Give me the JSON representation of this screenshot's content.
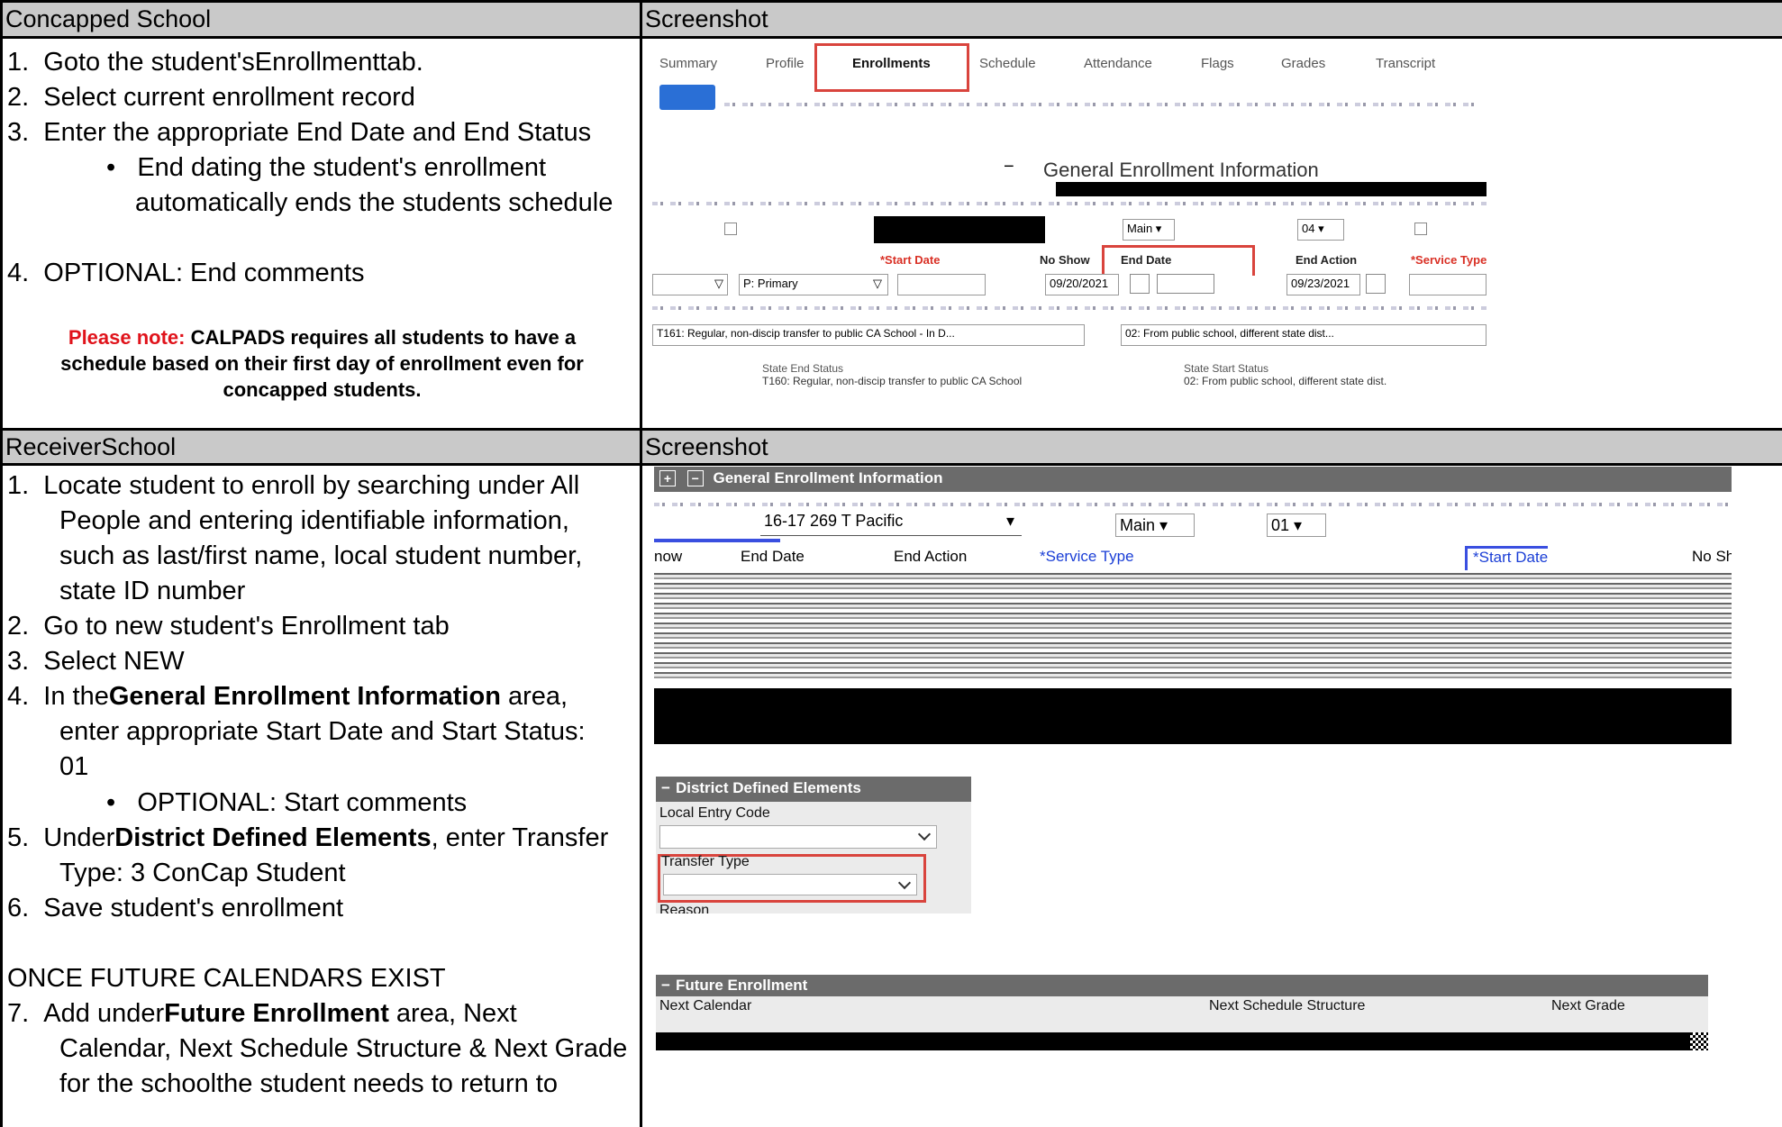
{
  "section1": {
    "left_header": "Concapped School",
    "right_header": "Screenshot",
    "steps": [
      "1.  Goto the student'sEnrollmenttab.",
      "2.  Select current enrollment record",
      "3.  Enter the appropriate End Date and End Status",
      "•   End dating the student's enrollment",
      "automatically ends the students schedule",
      "4.  OPTIONAL: End comments"
    ],
    "note_red": "Please note:",
    "note_line1": " CALPADS requires all students to have a",
    "note_line2": "schedule based on their first day of enrollment even for",
    "note_line3": "concapped students."
  },
  "screenshot1": {
    "tabs": [
      "Summary",
      "Profile",
      "Enrollments",
      "Schedule",
      "Attendance",
      "Flags",
      "Grades",
      "Transcript"
    ],
    "section_title": "General Enrollment Information",
    "collapse_glyph": "−",
    "calendar_value": "Main ▾",
    "grade_value": "04 ▾",
    "start_date_label": "*Start Date",
    "no_show_label": "No Show",
    "end_date_label": "End Date",
    "end_action_label": "End Action",
    "service_type_label": "*Service Type",
    "service_value": "P: Primary",
    "dropdown_glyph": "▽",
    "no_show_date": "09/20/2021",
    "end_action_date": "09/23/2021",
    "end_status_text": "T161: Regular, non-discip transfer to public CA School - In D...",
    "start_status_text": "02: From public school, different state dist...",
    "state_end_label": "State End Status",
    "state_end_text": "T160: Regular, non-discip transfer to public CA School",
    "state_start_label": "State Start Status",
    "state_start_text": "02: From public school, different state dist."
  },
  "section2": {
    "left_header": "ReceiverSchool",
    "right_header": "Screenshot",
    "steps": [
      "1.  Locate student to enroll by searching under All",
      "People and entering identifiable information,",
      "such as last/first name, local student number,",
      "state ID number",
      "2.  Go to new student's Enrollment tab",
      "3.  Select NEW",
      "4.  In the",
      "General Enrollment Information",
      " area,",
      "enter appropriate Start Date and Start Status:",
      "01",
      "•   OPTIONAL: Start comments",
      "5.  Under",
      "District Defined Elements",
      ", enter Transfer",
      "Type: 3 ConCap Student",
      "6.  Save student's enrollment",
      "ONCE FUTURE CALENDARS EXIST",
      "7.  Add under",
      "Future Enrollment",
      " area, Next",
      "Calendar, Next Schedule Structure & Next Grade",
      "for the schoolthe student needs to return to"
    ]
  },
  "screenshot2": {
    "expand_glyph": "+",
    "collapse_glyph": "−",
    "panel_title": "General Enrollment Information",
    "calendar_value": "16-17 269 T Pacific",
    "schedule_value": "Main ▾",
    "grade_value": "01 ▾",
    "dropdown_glyph": "▾",
    "col_now": "now",
    "col_end_date": "End Date",
    "col_end_action": "End Action",
    "col_service_type": "*Service Type",
    "col_start_date": "*Start Date",
    "col_no_show": "No Sh"
  },
  "district_panel": {
    "title": "District Defined Elements",
    "local_entry_label": "Local Entry Code",
    "transfer_type_label": "Transfer Type",
    "reason_label": "Reason"
  },
  "future_panel": {
    "title": "Future Enrollment",
    "next_calendar_label": "Next Calendar",
    "next_schedule_label": "Next Schedule Structure",
    "next_grade_label": "Next Grade"
  }
}
